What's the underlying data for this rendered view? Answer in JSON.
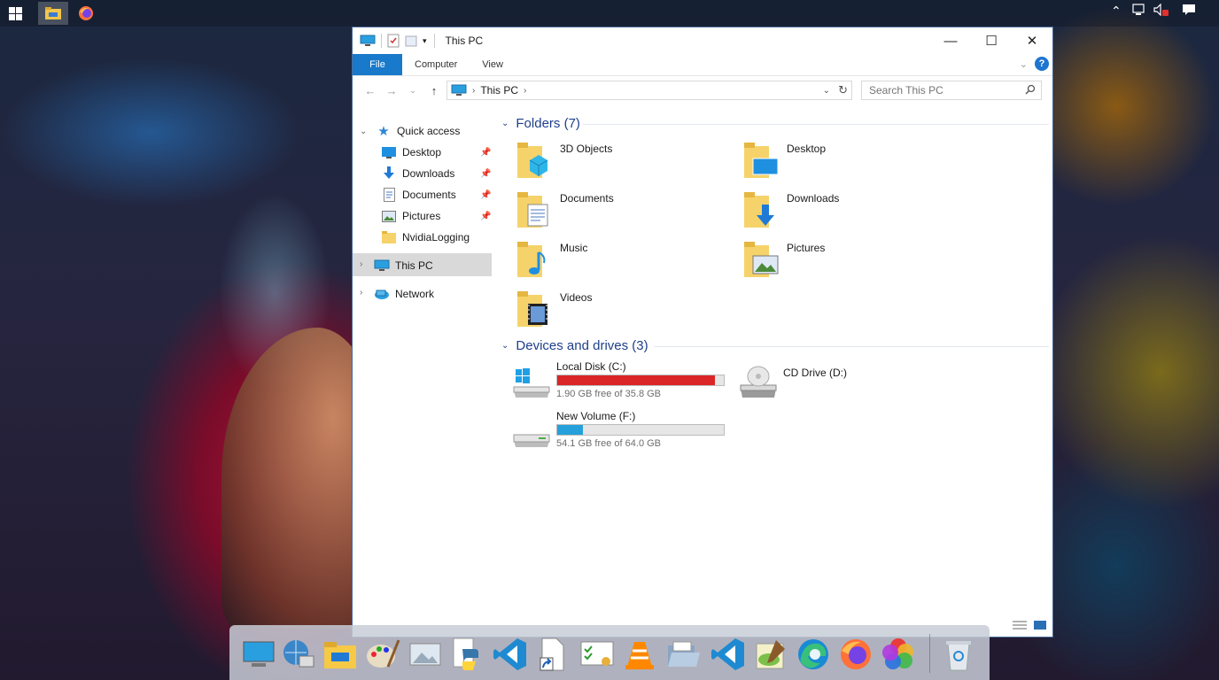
{
  "window": {
    "title": "This PC",
    "ribbon_tabs": [
      "File",
      "Computer",
      "View"
    ],
    "address": "This PC",
    "search_placeholder": "Search This PC"
  },
  "nav_pane": {
    "quick_access": "Quick access",
    "quick_items": [
      {
        "label": "Desktop",
        "icon": "desktop-icon",
        "pinned": true
      },
      {
        "label": "Downloads",
        "icon": "downloads-icon",
        "pinned": true
      },
      {
        "label": "Documents",
        "icon": "documents-icon",
        "pinned": true
      },
      {
        "label": "Pictures",
        "icon": "pictures-icon",
        "pinned": true
      },
      {
        "label": "NvidiaLogging",
        "icon": "folder-icon",
        "pinned": false
      }
    ],
    "this_pc": "This PC",
    "network": "Network"
  },
  "folders": {
    "heading": "Folders (7)",
    "items": [
      {
        "label": "3D Objects",
        "icon": "3d-objects-folder-icon"
      },
      {
        "label": "Desktop",
        "icon": "desktop-folder-icon"
      },
      {
        "label": "Documents",
        "icon": "documents-folder-icon"
      },
      {
        "label": "Downloads",
        "icon": "downloads-folder-icon"
      },
      {
        "label": "Music",
        "icon": "music-folder-icon"
      },
      {
        "label": "Pictures",
        "icon": "pictures-folder-icon"
      },
      {
        "label": "Videos",
        "icon": "videos-folder-icon"
      }
    ]
  },
  "devices": {
    "heading": "Devices and drives (3)",
    "drives": [
      {
        "label": "Local Disk (C:)",
        "free_text": "1.90 GB free of 35.8 GB",
        "used_fraction": 0.947,
        "bar_color": "#da2626",
        "icon": "windows-drive-icon"
      },
      {
        "label": "CD Drive (D:)",
        "icon": "cd-drive-icon"
      },
      {
        "label": "New Volume (F:)",
        "free_text": "54.1 GB free of 64.0 GB",
        "used_fraction": 0.155,
        "bar_color": "#26a0da",
        "icon": "hard-drive-icon"
      }
    ]
  },
  "colors": {
    "file_tab": "#1979ca",
    "group_heading": "#1e3f8a"
  },
  "dock": {
    "items": [
      "computer-icon",
      "network-globe-icon",
      "file-explorer-icon",
      "paint-icon",
      "image-viewer-icon",
      "python-icon",
      "vscode-icon",
      "shortcut-icon",
      "certificate-icon",
      "vlc-icon",
      "folder-open-icon",
      "vscode-icon",
      "notepad-plus-icon",
      "edge-icon",
      "firefox-icon",
      "color-wheel-icon",
      "recycle-bin-icon"
    ]
  },
  "taskbar": {
    "items": [
      "start-icon",
      "file-explorer-icon",
      "firefox-icon"
    ],
    "tray": [
      "chevron-up-icon",
      "network-icon",
      "volume-muted-icon",
      "notifications-icon"
    ]
  }
}
